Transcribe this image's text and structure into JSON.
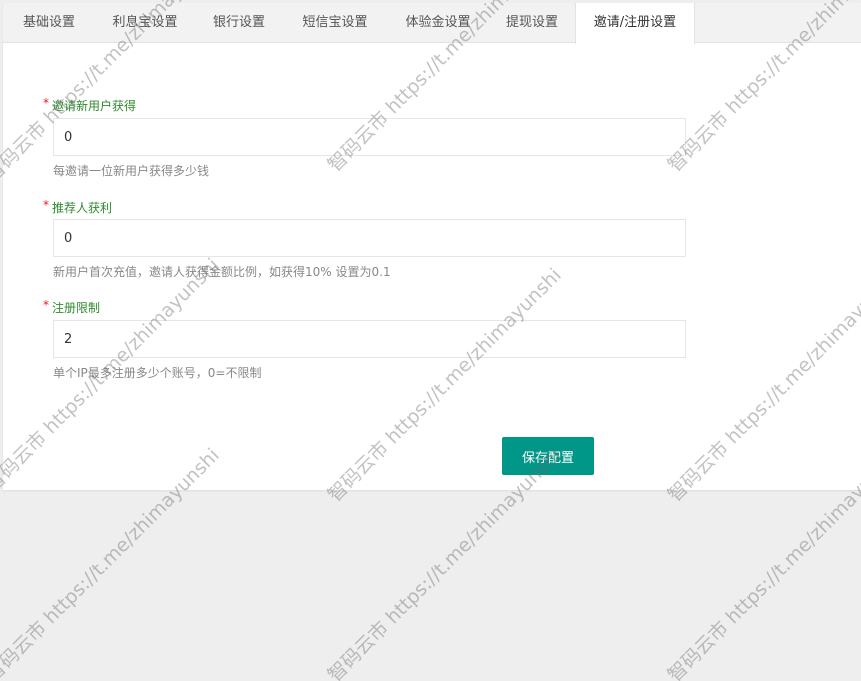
{
  "tabs": [
    {
      "label": "基础设置"
    },
    {
      "label": "利息宝设置"
    },
    {
      "label": "银行设置"
    },
    {
      "label": "短信宝设置"
    },
    {
      "label": "体验金设置"
    },
    {
      "label": "提现设置"
    },
    {
      "label": "邀请/注册设置"
    }
  ],
  "active_tab": "邀请/注册设置",
  "form": {
    "fields": [
      {
        "label": "邀请新用户获得",
        "value": "0",
        "hint": "每邀请一位新用户获得多少钱",
        "required_mark": "*"
      },
      {
        "label": "推荐人获利",
        "value": "0",
        "hint": "新用户首次充值，邀请人获得金额比例，如获得10% 设置为0.1",
        "required_mark": "*"
      },
      {
        "label": "注册限制",
        "value": "2",
        "hint": "单个IP最多注册多少个账号，0=不限制",
        "required_mark": "*"
      }
    ],
    "save_label": "保存配置"
  },
  "watermark_text": "智码云市 https://t.me/zhimayunshi",
  "colors": {
    "accent": "#009688",
    "label_green": "#2e8b2e",
    "required_red": "#e02020",
    "background": "#eeeeee"
  }
}
